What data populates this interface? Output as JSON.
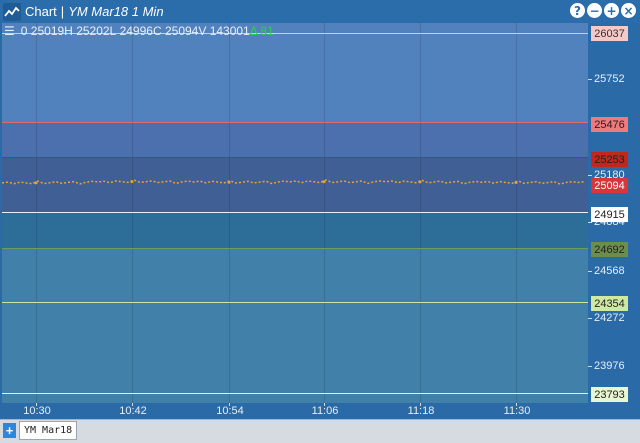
{
  "window": {
    "title": "Chart",
    "separator": "|",
    "subtitle": "YM Mar18 1 Min",
    "buttons": [
      "?",
      "−",
      "+",
      "×"
    ]
  },
  "ohlc": {
    "o": "0",
    "h": "25019H",
    "l": "25202L",
    "c": "24996C",
    "v": "25094V",
    "vol": "143001",
    "change": "Δ 81"
  },
  "colors": {
    "change": "#2bd14b"
  },
  "yaxis": {
    "ticks": [
      "25752",
      "25180",
      "24884",
      "24568",
      "24272",
      "23976"
    ]
  },
  "levels": [
    {
      "label": "26037",
      "bg": "#f6c9c9",
      "fg": "#333333"
    },
    {
      "label": "25476",
      "bg": "#ec7b7b",
      "fg": "#222222"
    },
    {
      "label": "25253",
      "bg": "#c0281e",
      "fg": "#222222"
    },
    {
      "label": "25094",
      "bg": "#d9363b",
      "fg": "#ffffff"
    },
    {
      "label": "24915",
      "bg": "#ffffff",
      "fg": "#222222"
    },
    {
      "label": "24692",
      "bg": "#6c8d4c",
      "fg": "#222222"
    },
    {
      "label": "24354",
      "bg": "#cfe9a3",
      "fg": "#222222"
    },
    {
      "label": "23793",
      "bg": "#e9f6d3",
      "fg": "#222222"
    }
  ],
  "xaxis": {
    "ticks": [
      "10:30",
      "10:42",
      "10:54",
      "11:06",
      "11:18",
      "11:30"
    ]
  },
  "tabs": {
    "add": "+",
    "items": [
      "YM Mar18"
    ]
  },
  "chart_data": {
    "type": "line",
    "symbol": "YM Mar18",
    "interval": "1 Min",
    "x": [
      "10:30",
      "10:42",
      "10:54",
      "11:06",
      "11:18",
      "11:30"
    ],
    "series": [
      {
        "values": [
          25094,
          25102,
          25098,
          25101,
          25100,
          25096
        ]
      }
    ],
    "yticks": [
      25752,
      25180,
      24884,
      24568,
      24272,
      23976
    ],
    "levels": [
      26037,
      25476,
      25253,
      25094,
      24915,
      24692,
      24354,
      23793
    ],
    "grid": true
  }
}
